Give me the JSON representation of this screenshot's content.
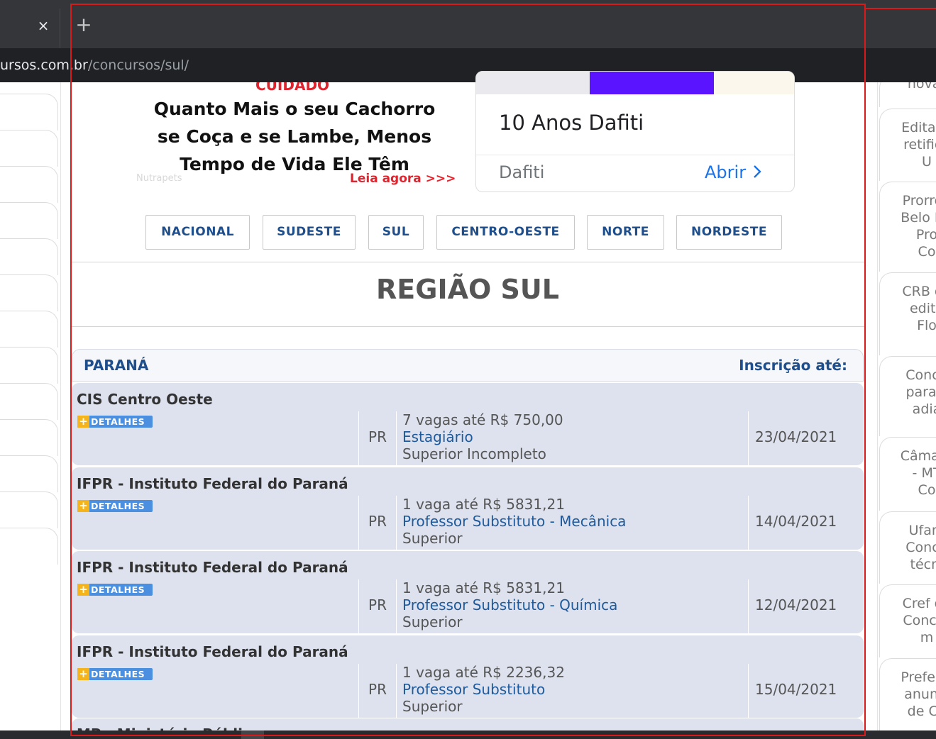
{
  "browser": {
    "tab_close": "×",
    "new_tab": "+",
    "url_host": "ursos.com.br",
    "url_path": "/concursos/sul/"
  },
  "ads": {
    "ad1": {
      "warning": "CUIDADO",
      "headline_lines": [
        "Quanto Mais o seu Cachorro",
        "se Coça e se Lambe, Menos",
        "Tempo de Vida Ele Têm"
      ],
      "source": "Nutrapets",
      "cta": "Leia agora >>>"
    },
    "ad2": {
      "title": "10 Anos Dafiti",
      "brand": "Dafiti",
      "open_label": "Abrir"
    }
  },
  "region_nav": [
    "NACIONAL",
    "SUDESTE",
    "SUL",
    "CENTRO-OESTE",
    "NORTE",
    "NORDESTE"
  ],
  "page_title": "REGIÃO SUL",
  "table": {
    "state": "PARANÁ",
    "deadline_header": "Inscrição até:",
    "details_label": "DETALHES",
    "rows": [
      {
        "org": "CIS Centro Oeste",
        "uf": "PR",
        "vagas": "7 vagas até R$ 750,00",
        "cargo": "Estagiário",
        "nivel": "Superior Incompleto",
        "date": "23/04/2021"
      },
      {
        "org": "IFPR - Instituto Federal do Paraná",
        "uf": "PR",
        "vagas": "1 vaga até R$ 5831,21",
        "cargo": "Professor Substituto - Mecânica",
        "nivel": "Superior",
        "date": "14/04/2021"
      },
      {
        "org": "IFPR - Instituto Federal do Paraná",
        "uf": "PR",
        "vagas": "1 vaga até R$ 5831,21",
        "cargo": "Professor Substituto - Química",
        "nivel": "Superior",
        "date": "12/04/2021"
      },
      {
        "org": "IFPR - Instituto Federal do Paraná",
        "uf": "PR",
        "vagas": "1 vaga até R$ 2236,32",
        "cargo": "Professor Substituto",
        "nivel": "Superior",
        "date": "15/04/2021"
      }
    ],
    "partial_row_org": "MP - Ministério Público"
  },
  "right_sidebar": [
    [
      "novar"
    ],
    [
      "Edital d",
      "retifica",
      "U"
    ],
    [
      "Prorrog",
      "Belo Ho",
      "Pro",
      "Co"
    ],
    [
      "CRB da",
      "edita",
      "Flo"
    ],
    [
      "Concu",
      "para s",
      "adia"
    ],
    [
      "Câmara",
      "- MT",
      "Co"
    ],
    [
      "Ufam",
      "Concu",
      "técni"
    ],
    [
      "Cref da",
      "Concur",
      "m"
    ],
    [
      "Prefeitu",
      "anunci",
      "de Co"
    ]
  ],
  "colors": {
    "accent": "#1e4f8c",
    "link": "#1e5a9c",
    "row_bg": "#dde2ee",
    "highlight": "#d91a1a"
  }
}
